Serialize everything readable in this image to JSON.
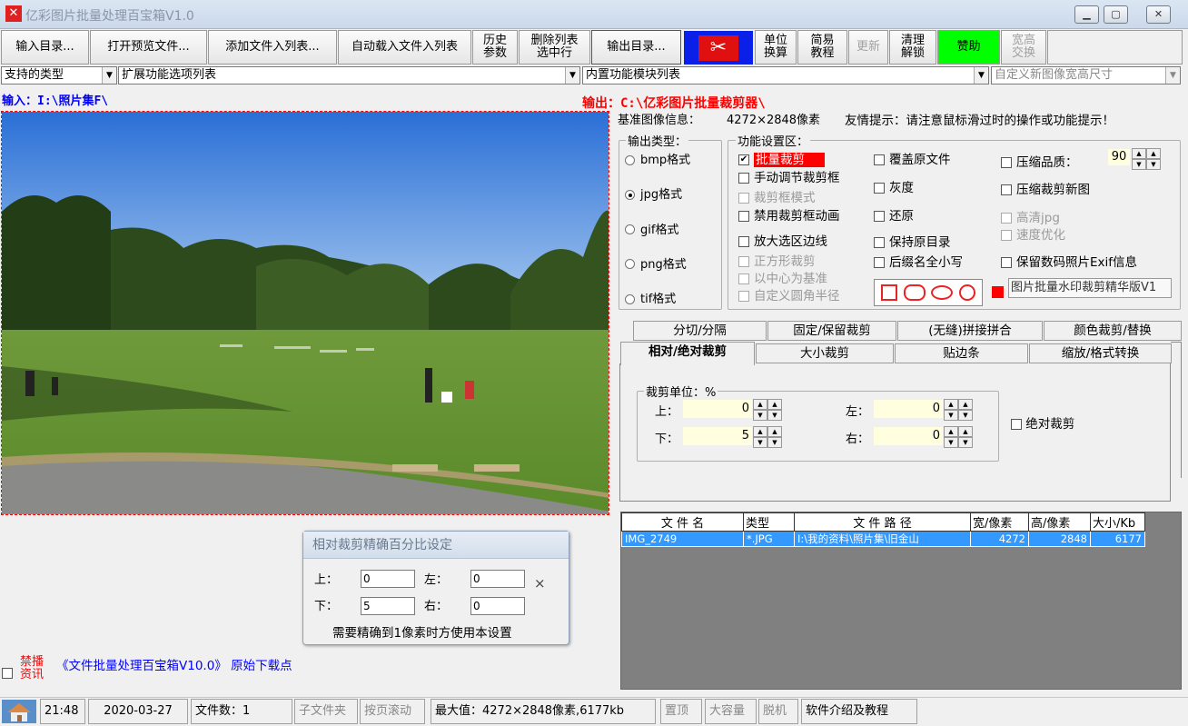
{
  "window": {
    "title": "亿彩图片批量处理百宝箱V1.0",
    "app_icon_glyph": "✕"
  },
  "toolbar": {
    "input_dir": "输入目录...",
    "open_preview": "打开预览文件...",
    "add_to_list": "添加文件入列表...",
    "auto_load": "自动载入文件入列表",
    "history_l1": "历史",
    "history_l2": "参数",
    "delete_l1": "删除列表",
    "delete_l2": "选中行",
    "output_dir": "输出目录...",
    "unit_l1": "单位",
    "unit_l2": "换算",
    "tutorial_l1": "简易",
    "tutorial_l2": "教程",
    "update": "更新",
    "unlock_l1": "清理",
    "unlock_l2": "解锁",
    "donate": "赞助",
    "swap_l1": "宽高",
    "swap_l2": "交换"
  },
  "dropdowns": {
    "types": "支持的类型",
    "ext_list": "扩展功能选项列表",
    "builtin": "内置功能模块列表",
    "custom_size": "自定义新图像宽高尺寸"
  },
  "paths": {
    "input": "输入：I:\\照片集F\\",
    "output": "输出：C:\\亿彩图片批量裁剪器\\"
  },
  "info": {
    "base_label": "基准图像信息：",
    "base_value": "4272×2848像素",
    "tip": "友情提示：请注意鼠标滑过时的操作或功能提示！"
  },
  "output_type": {
    "title": "输出类型：",
    "options": [
      "bmp格式",
      "jpg格式",
      "gif格式",
      "png格式",
      "tif格式"
    ],
    "selected_index": 1
  },
  "function_area": {
    "title": "功能设置区：",
    "col1": [
      {
        "label": "批量裁剪",
        "checked": true,
        "disabled": false,
        "highlight": true
      },
      {
        "label": "手动调节裁剪框",
        "checked": false,
        "disabled": false
      },
      {
        "label": "裁剪框模式",
        "checked": false,
        "disabled": true
      },
      {
        "label": "禁用裁剪框动画",
        "checked": false,
        "disabled": false
      },
      {
        "label": "放大选区边线",
        "checked": false,
        "disabled": false
      },
      {
        "label": "正方形裁剪",
        "checked": false,
        "disabled": true
      },
      {
        "label": "以中心为基准",
        "checked": false,
        "disabled": true
      },
      {
        "label": "自定义圆角半径",
        "checked": false,
        "disabled": true
      }
    ],
    "col2": [
      {
        "label": "覆盖原文件"
      },
      {
        "label": "灰度"
      },
      {
        "label": "还原"
      },
      {
        "label": "保持原目录"
      },
      {
        "label": "后缀名全小写"
      }
    ],
    "col3": [
      {
        "label": "压缩品质：",
        "disabled": false
      },
      {
        "label": "压缩裁剪新图",
        "disabled": false
      },
      {
        "label": "高清jpg",
        "disabled": true
      },
      {
        "label": "速度优化",
        "disabled": true
      },
      {
        "label": "保留数码照片Exif信息",
        "disabled": false
      }
    ],
    "quality_value": "90",
    "watermark_text": "图片批量水印裁剪精华版V1"
  },
  "tabs_row1": [
    "分切/分隔",
    "固定/保留裁剪",
    "(无缝)拼接拼合",
    "颜色裁剪/替换"
  ],
  "tabs_row2": [
    "相对/绝对裁剪",
    "大小裁剪",
    "贴边条",
    "缩放/格式转换"
  ],
  "crop_panel": {
    "unit_label": "裁剪单位：%",
    "top_label": "上：",
    "top_value": "0",
    "bottom_label": "下：",
    "bottom_value": "5",
    "left_label": "左：",
    "left_value": "0",
    "right_label": "右：",
    "right_value": "0",
    "absolute_label": "绝对裁剪"
  },
  "file_table": {
    "headers": [
      "文 件 名",
      "类型",
      "文 件 路 径",
      "宽/像素",
      "高/像素",
      "大小/Kb"
    ],
    "rows": [
      [
        "IMG_2749",
        "*.JPG",
        "I:\\我的资料\\照片集\\旧金山",
        "4272",
        "2848",
        "6177"
      ]
    ]
  },
  "precise_dialog": {
    "title": "相对裁剪精确百分比设定",
    "top_label": "上：",
    "top_value": "0",
    "left_label": "左：",
    "left_value": "0",
    "bottom_label": "下：",
    "bottom_value": "5",
    "right_label": "右：",
    "right_value": "0",
    "note": "需要精确到1像素时方使用本设置",
    "close": "×"
  },
  "ad": {
    "ban_l1": "禁播",
    "ban_l2": "资讯",
    "link": "《文件批量处理百宝箱V10.0》 原始下载点"
  },
  "statusbar": {
    "time": "21:48",
    "date": "2020-03-27",
    "file_count": "文件数：1",
    "subfolder": "子文件夹",
    "page_scroll": "按页滚动",
    "max_value": "最大值：4272×2848像素,6177kb",
    "top": "置顶",
    "big_capacity": "大容量",
    "offline": "脱机",
    "about": "软件介绍及教程"
  },
  "colors": {
    "accent_blue": "#0000ff",
    "accent_red": "#ff0000",
    "donate_green": "#00ff00",
    "selection_blue": "#3399ff"
  }
}
